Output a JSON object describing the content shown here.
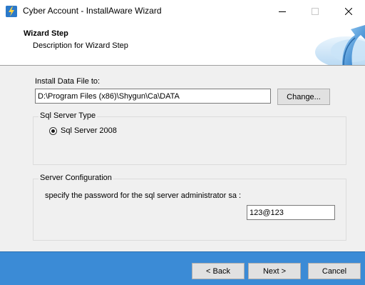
{
  "window": {
    "title": "Cyber Account - InstallAware Wizard"
  },
  "header": {
    "title": "Wizard Step",
    "description": "Description for Wizard Step"
  },
  "install": {
    "label": "Install Data File to:",
    "path_value": "D:\\Program Files (x86)\\Shygun\\Ca\\DATA",
    "change_label": "Change..."
  },
  "sql_server": {
    "group_label": "Sql Server Type",
    "option_label": "Sql Server 2008",
    "selected": true
  },
  "server_config": {
    "group_label": "Server Configuration",
    "prompt": "specify the password for the sql server administrator sa :",
    "password_value": "123@123"
  },
  "footer": {
    "back_label": "< Back",
    "next_label": "Next >",
    "cancel_label": "Cancel"
  },
  "colors": {
    "footer_bg": "#3b8bd6",
    "window_bg": "#f0f0f0"
  },
  "icons": {
    "app": "installaware-icon",
    "minimize": "minimize-icon",
    "maximize": "maximize-icon",
    "close": "close-icon",
    "banner": "wizard-arrow-graphic"
  }
}
